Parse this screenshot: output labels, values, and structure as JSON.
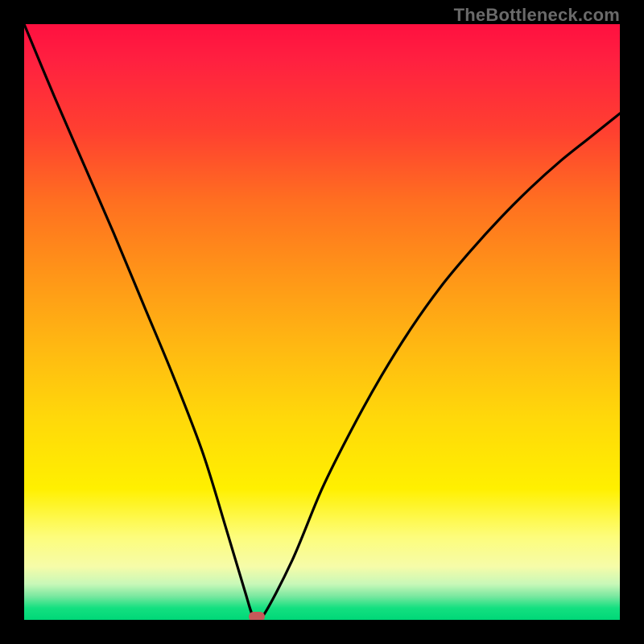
{
  "watermark": "TheBottleneck.com",
  "colors": {
    "frame": "#000000",
    "marker": "#c55a5a",
    "curve": "#000000"
  },
  "chart_data": {
    "type": "line",
    "title": "",
    "xlabel": "",
    "ylabel": "",
    "xlim": [
      0,
      100
    ],
    "ylim": [
      0,
      100
    ],
    "grid": false,
    "legend": null,
    "series": [
      {
        "name": "bottleneck-curve",
        "x": [
          0,
          5,
          10,
          15,
          20,
          25,
          30,
          34,
          37,
          38.5,
          40,
          45,
          50,
          55,
          60,
          65,
          70,
          75,
          80,
          85,
          90,
          95,
          100
        ],
        "y": [
          100,
          88,
          76.5,
          65,
          53,
          41,
          28,
          15,
          5,
          0.5,
          0.5,
          10,
          22,
          32,
          41,
          49,
          56,
          62,
          67.5,
          72.5,
          77,
          81,
          85
        ]
      }
    ],
    "min_point": {
      "x": 39,
      "y": 0.5
    },
    "description": "V-shaped bottleneck curve over a red-to-green vertical gradient. Minimum near x≈39. Left branch reaches top-left; right branch rises to about 85% at the right edge. Marker at the bottom of the valley."
  }
}
